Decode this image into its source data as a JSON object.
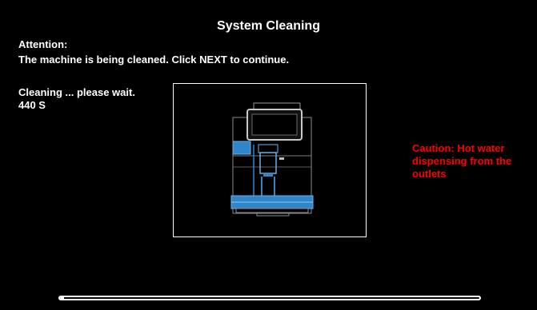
{
  "header": {
    "title": "System Cleaning"
  },
  "notice": {
    "attention": "Attention:",
    "message": "The machine is being cleaned. Click NEXT to continue."
  },
  "status": {
    "cleaning_text": "Cleaning ... please wait. 440 S"
  },
  "warning": {
    "caution_text": "Caution: Hot water dispensing from the outlets",
    "color": "#ff0000"
  },
  "illustration": {
    "icon": "coffee-machine-icon",
    "highlight_color": "#2f86c9"
  },
  "progress": {
    "fraction": 0.01
  }
}
